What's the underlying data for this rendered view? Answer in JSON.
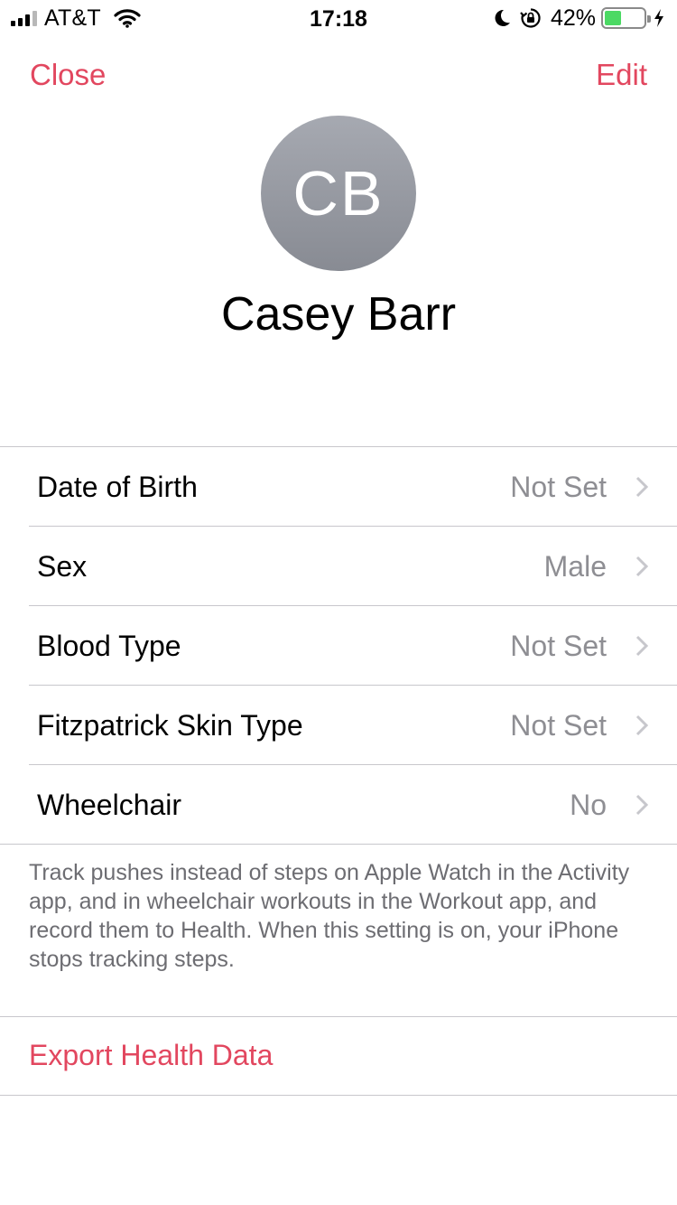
{
  "status_bar": {
    "carrier": "AT&T",
    "time": "17:18",
    "battery_percent": "42%",
    "battery_level": 0.42,
    "icons": [
      "signal-icon",
      "wifi-icon",
      "moon-icon",
      "orientation-lock-icon",
      "battery-icon",
      "charging-bolt-icon"
    ]
  },
  "nav": {
    "close_label": "Close",
    "edit_label": "Edit"
  },
  "profile": {
    "initials": "CB",
    "name": "Casey Barr"
  },
  "rows": [
    {
      "label": "Date of Birth",
      "value": "Not Set"
    },
    {
      "label": "Sex",
      "value": "Male"
    },
    {
      "label": "Blood Type",
      "value": "Not Set"
    },
    {
      "label": "Fitzpatrick Skin Type",
      "value": "Not Set"
    },
    {
      "label": "Wheelchair",
      "value": "No"
    }
  ],
  "footnote": "Track pushes instead of steps on Apple Watch in the Activity app, and in wheelchair workouts in the Workout app, and record them to Health. When this setting is on, your iPhone stops tracking steps.",
  "export_label": "Export Health Data",
  "colors": {
    "accent": "#e2475f",
    "secondary_text": "#8e8e93",
    "separator": "#c8c7cc",
    "battery_fill": "#4cd964"
  }
}
